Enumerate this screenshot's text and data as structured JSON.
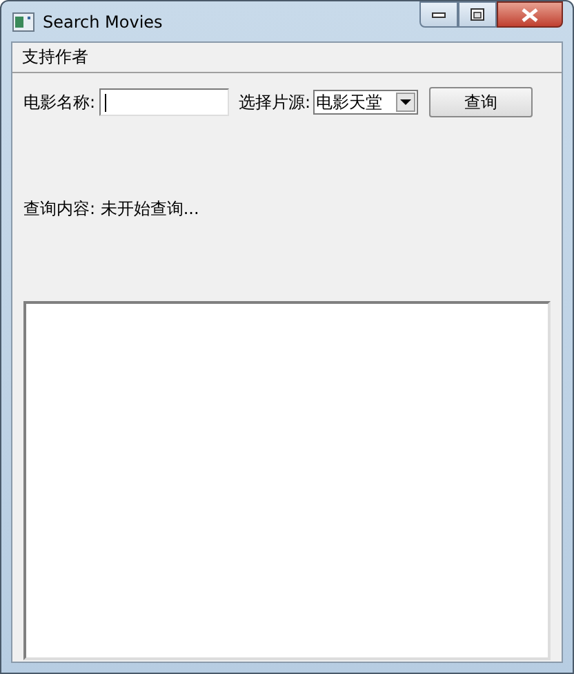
{
  "window": {
    "title": "Search Movies"
  },
  "menu": [
    "支持作者"
  ],
  "form": {
    "name_label": "电影名称:",
    "source_label": "选择片源:",
    "source_select": "电影天堂",
    "query_button": "查询"
  },
  "status": "查询内容: 未开始查询..."
}
